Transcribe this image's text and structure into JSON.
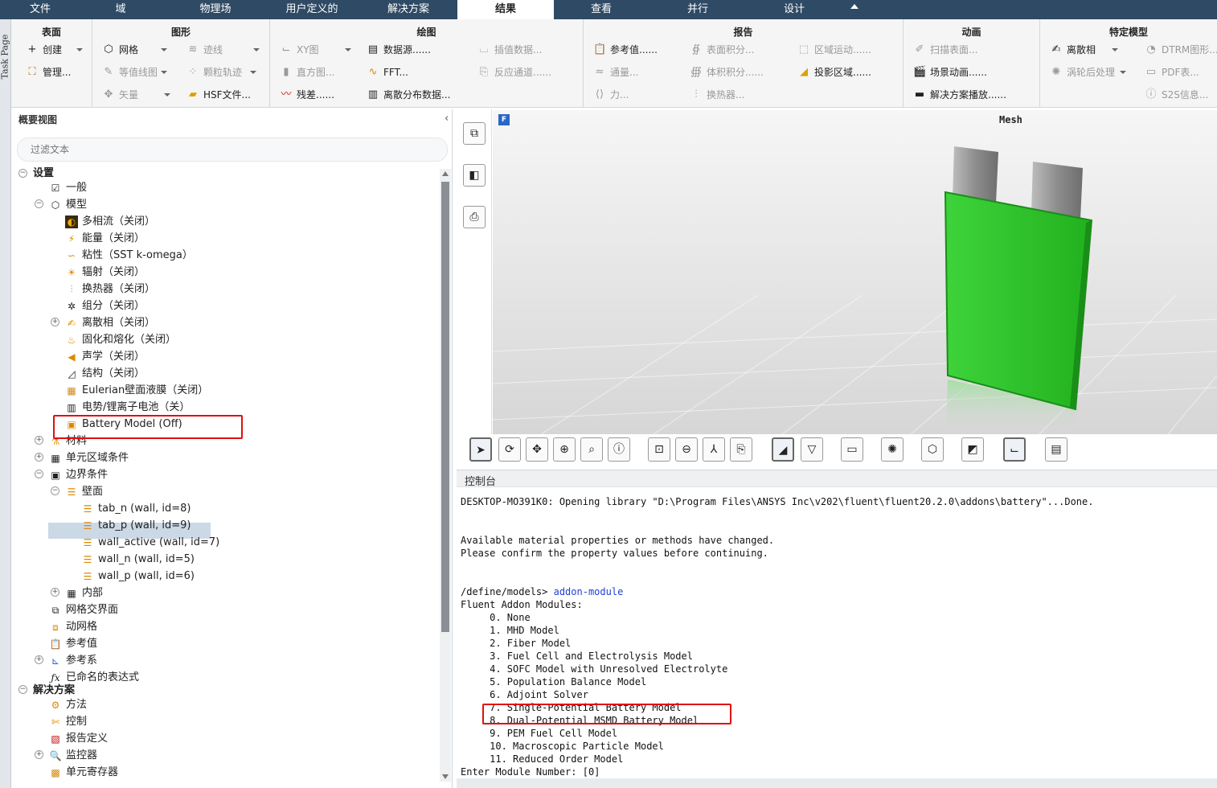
{
  "menubar": {
    "tabs": [
      "文件",
      "域",
      "物理场",
      "用户定义的",
      "解决方案",
      "结果",
      "查看",
      "并行",
      "设计"
    ],
    "active": "结果"
  },
  "taskpage": {
    "label": "Task Page"
  },
  "ribbon": {
    "groups": {
      "surface": {
        "title": "表面",
        "create": "创建",
        "manage": "管理..."
      },
      "graphics": {
        "title": "图形",
        "mesh": "网格",
        "contour": "等值线图",
        "vector": "矢量",
        "pathline": "迹线",
        "particle": "颗粒轨迹",
        "hsf": "HSF文件..."
      },
      "plot": {
        "title": "绘图",
        "xy": "XY图",
        "histogram": "直方图...",
        "residual": "残差......",
        "datasource": "数据源......",
        "fft": "FFT...",
        "dpm_dist": "离散分布数据...",
        "interp": "插值数据...",
        "reaction": "反应通道......"
      },
      "report": {
        "title": "报告",
        "ref": "参考值......",
        "flux": "通量...",
        "force": "力...",
        "surf_int": "表面积分...",
        "vol_int": "体积积分......",
        "hx": "换热器...",
        "zone_motion": "区域运动......",
        "proj": "投影区域......"
      },
      "anim": {
        "title": "动画",
        "sweep": "扫描表面...",
        "scene": "场景动画......",
        "playback": "解决方案播放......"
      },
      "model": {
        "title": "特定模型",
        "dpm": "离散相",
        "turbo": "涡轮后处理",
        "dtrm": "DTRM图形...",
        "pdf": "PDF表...",
        "s2s": "S2S信息..."
      }
    }
  },
  "outline": {
    "title": "概要视图",
    "filter_placeholder": "过滤文本",
    "setup": "设置",
    "general": "一般",
    "models": "模型",
    "model_items": [
      "多相流（关闭）",
      "能量（关闭）",
      "粘性（SST k-omega）",
      "辐射（关闭）",
      "换热器（关闭）",
      "组分（关闭）",
      "离散相（关闭）",
      "固化和熔化（关闭）",
      "声学（关闭）",
      "结构（关闭）",
      "Eulerian壁面液膜（关闭）",
      "电势/锂离子电池（关）",
      "Battery Model (Off)"
    ],
    "materials": "材料",
    "cell_zones": "单元区域条件",
    "boundary": "边界条件",
    "wall": "壁面",
    "walls": [
      "tab_n (wall, id=8)",
      "tab_p (wall, id=9)",
      "wall_active (wall, id=7)",
      "wall_n (wall, id=5)",
      "wall_p (wall, id=6)"
    ],
    "interior": "内部",
    "mesh_if": "网格交界面",
    "dyn_mesh": "动网格",
    "ref_values": "参考值",
    "ref_frame": "参考系",
    "named_expr": "已命名的表达式",
    "solution": "解决方案",
    "methods": "方法",
    "controls": "控制",
    "report_def": "报告定义",
    "monitors": "监控器",
    "cell_reg": "单元寄存器"
  },
  "viewport": {
    "title": "Mesh",
    "badge": "F",
    "cell_color": "#2ecc40"
  },
  "console": {
    "title": "控制台",
    "lines": [
      {
        "t": "DESKTOP-MO391K0: Opening library \"D:\\Program Files\\ANSYS Inc\\v202\\fluent\\fluent20.2.0\\addons\\battery\"...Done."
      },
      {
        "t": ""
      },
      {
        "t": ""
      },
      {
        "t": "Available material properties or methods have changed."
      },
      {
        "t": "Please confirm the property values before continuing."
      },
      {
        "t": ""
      },
      {
        "t": ""
      },
      {
        "t": "/define/models> ",
        "cmd": "addon-module"
      },
      {
        "t": "Fluent Addon Modules:"
      },
      {
        "t": "     0. None"
      },
      {
        "t": "     1. MHD Model"
      },
      {
        "t": "     2. Fiber Model"
      },
      {
        "t": "     3. Fuel Cell and Electrolysis Model"
      },
      {
        "t": "     4. SOFC Model with Unresolved Electrolyte"
      },
      {
        "t": "     5. Population Balance Model"
      },
      {
        "t": "     6. Adjoint Solver"
      },
      {
        "t": "     7. Single-Potential Battery Model"
      },
      {
        "t": "     8. Dual-Potential MSMD Battery Model"
      },
      {
        "t": "     9. PEM Fuel Cell Model"
      },
      {
        "t": "     10. Macroscopic Particle Model"
      },
      {
        "t": "     11. Reduced Order Model"
      },
      {
        "t": "Enter Module Number: [0]"
      }
    ]
  }
}
